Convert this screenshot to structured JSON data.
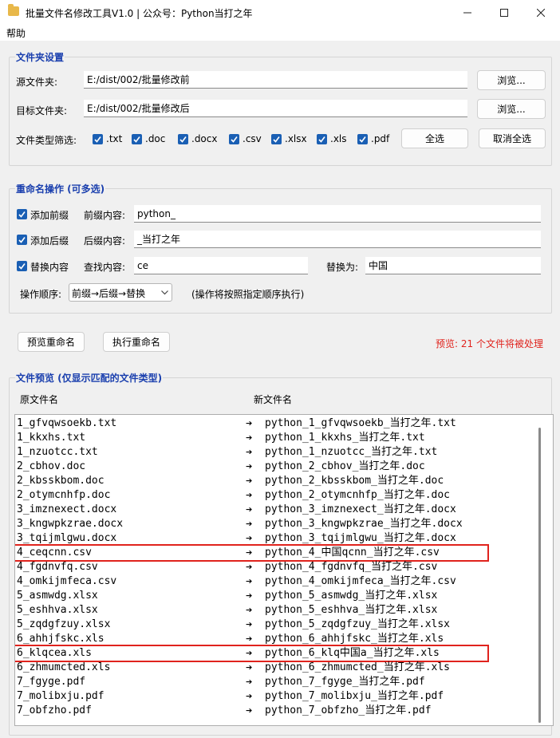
{
  "window": {
    "title": "批量文件名修改工具V1.0 | 公众号：Python当打之年",
    "minimize_icon": "minimize-icon",
    "maximize_icon": "maximize-icon",
    "close_icon": "close-icon"
  },
  "menu": {
    "help": "帮助"
  },
  "folder_settings": {
    "title": "文件夹设置",
    "source_label": "源文件夹:",
    "source_value": "E:/dist/002/批量修改前",
    "target_label": "目标文件夹:",
    "target_value": "E:/dist/002/批量修改后",
    "browse_label": "浏览...",
    "filter_label": "文件类型筛选:",
    "filters": [
      ".txt",
      ".doc",
      ".docx",
      ".csv",
      ".xlsx",
      ".xls",
      ".pdf"
    ],
    "select_all": "全选",
    "deselect_all": "取消全选"
  },
  "rename_ops": {
    "title": "重命名操作 (可多选)",
    "add_prefix": "添加前缀",
    "prefix_label": "前缀内容:",
    "prefix_value": "python_",
    "add_suffix": "添加后缀",
    "suffix_label": "后缀内容:",
    "suffix_value": "_当打之年",
    "replace": "替换内容",
    "find_label": "查找内容:",
    "find_value": "ce",
    "replace_label": "替换为:",
    "replace_value": "中国",
    "order_label": "操作顺序:",
    "order_value": "前缀→后缀→替换",
    "order_note": "(操作将按照指定顺序执行)"
  },
  "actions": {
    "preview": "预览重命名",
    "execute": "执行重命名",
    "status": "预览: 21 个文件将被处理"
  },
  "preview": {
    "title": "文件预览 (仅显示匹配的文件类型)",
    "col_old": "原文件名",
    "col_new": "新文件名",
    "arrow": "➔",
    "rows": [
      {
        "old": "1_gfvqwsoekb.txt",
        "new": "python_1_gfvqwsoekb_当打之年.txt"
      },
      {
        "old": "1_kkxhs.txt",
        "new": "python_1_kkxhs_当打之年.txt"
      },
      {
        "old": "1_nzuotcc.txt",
        "new": "python_1_nzuotcc_当打之年.txt"
      },
      {
        "old": "2_cbhov.doc",
        "new": "python_2_cbhov_当打之年.doc"
      },
      {
        "old": "2_kbsskbom.doc",
        "new": "python_2_kbsskbom_当打之年.doc"
      },
      {
        "old": "2_otymcnhfp.doc",
        "new": "python_2_otymcnhfp_当打之年.doc"
      },
      {
        "old": "3_imznexect.docx",
        "new": "python_3_imznexect_当打之年.docx"
      },
      {
        "old": "3_kngwpkzrae.docx",
        "new": "python_3_kngwpkzrae_当打之年.docx"
      },
      {
        "old": "3_tqijmlgwu.docx",
        "new": "python_3_tqijmlgwu_当打之年.docx"
      },
      {
        "old": "4_ceqcnn.csv",
        "new": "python_4_中国qcnn_当打之年.csv",
        "highlight": true
      },
      {
        "old": "4_fgdnvfq.csv",
        "new": "python_4_fgdnvfq_当打之年.csv"
      },
      {
        "old": "4_omkijmfeca.csv",
        "new": "python_4_omkijmfeca_当打之年.csv"
      },
      {
        "old": "5_asmwdg.xlsx",
        "new": "python_5_asmwdg_当打之年.xlsx"
      },
      {
        "old": "5_eshhva.xlsx",
        "new": "python_5_eshhva_当打之年.xlsx"
      },
      {
        "old": "5_zqdgfzuy.xlsx",
        "new": "python_5_zqdgfzuy_当打之年.xlsx"
      },
      {
        "old": "6_ahhjfskc.xls",
        "new": "python_6_ahhjfskc_当打之年.xls"
      },
      {
        "old": "6_klqcea.xls",
        "new": "python_6_klq中国a_当打之年.xls",
        "highlight": true
      },
      {
        "old": "6_zhmumcted.xls",
        "new": "python_6_zhmumcted_当打之年.xls"
      },
      {
        "old": "7_fgyge.pdf",
        "new": "python_7_fgyge_当打之年.pdf"
      },
      {
        "old": "7_molibxju.pdf",
        "new": "python_7_molibxju_当打之年.pdf"
      },
      {
        "old": "7_obfzho.pdf",
        "new": "python_7_obfzho_当打之年.pdf"
      }
    ]
  },
  "colors": {
    "accent": "#1a3fae",
    "checkbox": "#1a5fb4",
    "status": "#e0231d",
    "highlight": "#e0231d"
  }
}
